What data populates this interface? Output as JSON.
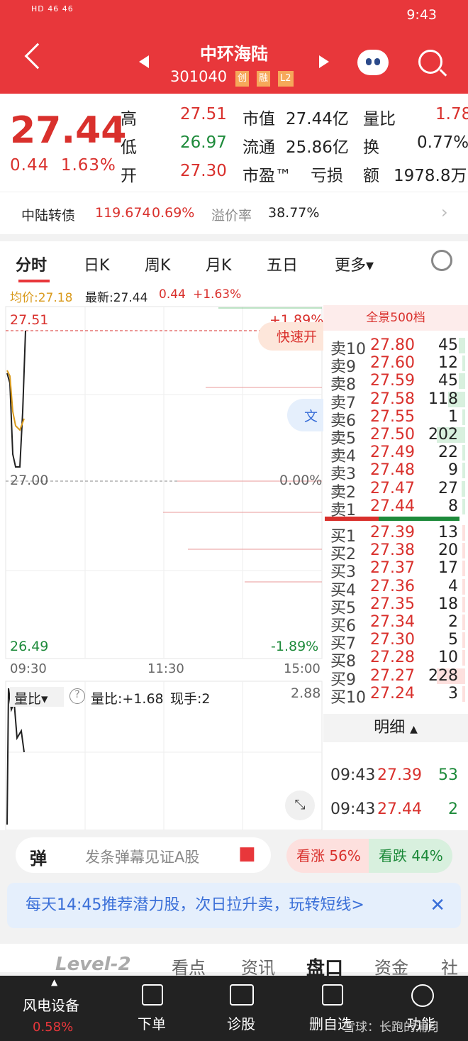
{
  "status": {
    "left": "HD 46 46",
    "time": "9:43"
  },
  "header": {
    "name": "中环海陆",
    "code": "301040",
    "tags": [
      "创",
      "融",
      "L2"
    ]
  },
  "quote": {
    "price": "27.44",
    "change": "0.44",
    "change_pct": "1.63%",
    "rows": [
      [
        "高",
        "27.51",
        "市值",
        "27.44亿",
        "量比",
        "1.78"
      ],
      [
        "低",
        "26.97",
        "流通",
        "25.86亿",
        "换",
        "0.77%"
      ],
      [
        "开",
        "27.30",
        "市盈™",
        "亏损",
        "额",
        "1978.8万"
      ]
    ]
  },
  "bond": {
    "name": "中陆转债",
    "price": "119.674",
    "pct": "0.69%",
    "premium_label": "溢价率",
    "premium": "38.77%"
  },
  "tabs": [
    "分时",
    "日K",
    "周K",
    "月K",
    "五日",
    "更多▾"
  ],
  "avg_line": {
    "avg": "均价:27.18",
    "latest": "最新:27.44",
    "change": "0.44",
    "pct": "+1.63%"
  },
  "chart": {
    "top": "27.51",
    "mid": "27.00",
    "bottom": "26.49",
    "top_pct": "+1.89%",
    "mid_pct": "0.00%",
    "bottom_pct": "-1.89%",
    "times": [
      "09:30",
      "11:30",
      "15:00"
    ],
    "quick": "快速开",
    "wen": "文"
  },
  "orderbook": {
    "title": "全景500档",
    "sells": [
      {
        "label": "卖10",
        "price": "27.80",
        "vol": "45"
      },
      {
        "label": "卖9",
        "price": "27.60",
        "vol": "12"
      },
      {
        "label": "卖8",
        "price": "27.59",
        "vol": "45"
      },
      {
        "label": "卖7",
        "price": "27.58",
        "vol": "118"
      },
      {
        "label": "卖6",
        "price": "27.55",
        "vol": "1"
      },
      {
        "label": "卖5",
        "price": "27.50",
        "vol": "202"
      },
      {
        "label": "卖4",
        "price": "27.49",
        "vol": "22"
      },
      {
        "label": "卖3",
        "price": "27.48",
        "vol": "9"
      },
      {
        "label": "卖2",
        "price": "27.47",
        "vol": "27"
      },
      {
        "label": "卖1",
        "price": "27.44",
        "vol": "8"
      }
    ],
    "buys": [
      {
        "label": "买1",
        "price": "27.39",
        "vol": "13"
      },
      {
        "label": "买2",
        "price": "27.38",
        "vol": "20"
      },
      {
        "label": "买3",
        "price": "27.37",
        "vol": "17"
      },
      {
        "label": "买4",
        "price": "27.36",
        "vol": "4"
      },
      {
        "label": "买5",
        "price": "27.35",
        "vol": "18"
      },
      {
        "label": "买6",
        "price": "27.34",
        "vol": "2"
      },
      {
        "label": "买7",
        "price": "27.30",
        "vol": "5"
      },
      {
        "label": "买8",
        "price": "27.28",
        "vol": "10"
      },
      {
        "label": "买9",
        "price": "27.27",
        "vol": "228"
      },
      {
        "label": "买10",
        "price": "27.24",
        "vol": "3"
      }
    ],
    "detail_title": "明细",
    "details": [
      {
        "time": "09:43",
        "price": "27.39",
        "vol": "53"
      },
      {
        "time": "09:43",
        "price": "27.44",
        "vol": "2"
      }
    ]
  },
  "volume": {
    "label": "量比▾",
    "ratio": "量比:+1.68",
    "hand": "现手:2",
    "max": "2.88"
  },
  "misc": {
    "danmaku_icon": "弹",
    "danmaku_placeholder": "发条弹幕见证A股",
    "up": "看涨 56%",
    "down": "看跌 44%",
    "banner": "每天14:45推荐潜力股，次日拉升卖，玩转短线>",
    "subtabs": [
      "Level-2",
      "看点",
      "资讯",
      "盘口",
      "资金",
      "社"
    ]
  },
  "bottomnav": {
    "sector": "风电设备",
    "sector_pct": "0.58%",
    "items": [
      "下单",
      "诊股",
      "删自选",
      "功能"
    ],
    "watermark": "雪球：长跑的浦月"
  }
}
